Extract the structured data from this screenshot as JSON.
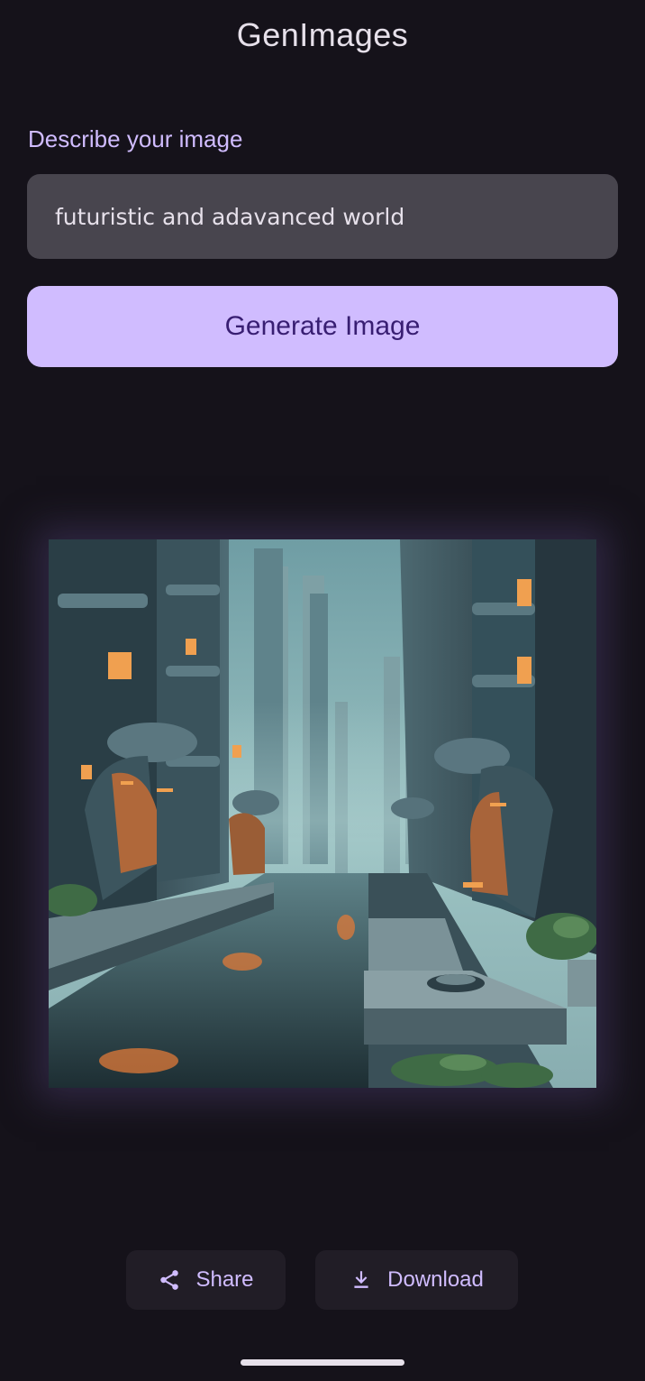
{
  "app": {
    "title": "GenImages"
  },
  "prompt": {
    "label": "Describe your image",
    "value": "futuristic and adavanced world",
    "placeholder": ""
  },
  "actions": {
    "generate_label": "Generate Image",
    "share_label": "Share",
    "download_label": "Download"
  },
  "icons": {
    "share": "share-icon",
    "download": "download-icon"
  },
  "colors": {
    "background": "#15121a",
    "accent": "#d0bcff",
    "on_accent": "#381e72",
    "input_bg": "#48454e",
    "text": "#e6e0ea"
  }
}
